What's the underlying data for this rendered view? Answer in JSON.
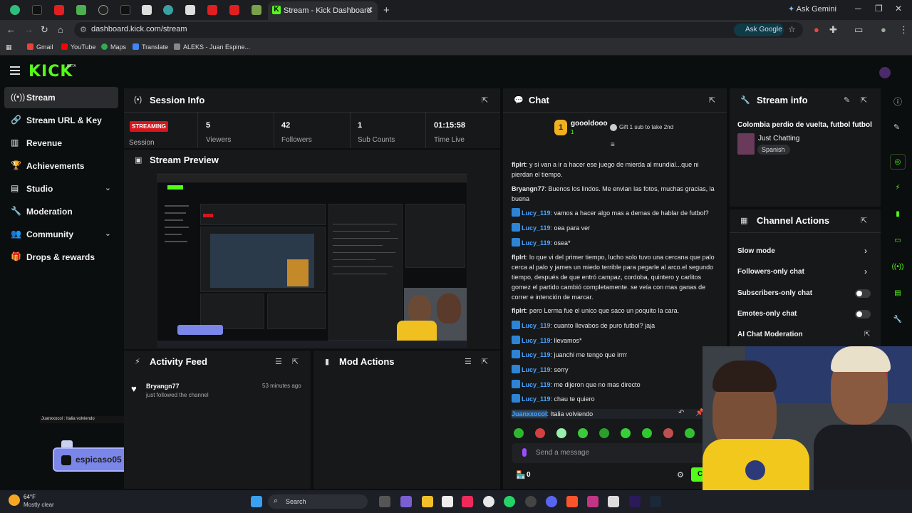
{
  "browser": {
    "active_tab_title": "Stream - Kick Dashboard",
    "ask_gemini": "Ask Gemini",
    "url": "dashboard.kick.com/stream",
    "ask_google": "Ask Google",
    "bookmarks": [
      "Gmail",
      "YouTube",
      "Maps",
      "Translate",
      "ALEKS - Juan Espine..."
    ]
  },
  "header": {
    "logo": "KICK",
    "beta": "BETA"
  },
  "sidebar": {
    "items": [
      {
        "label": "Stream",
        "icon": "broadcast-icon"
      },
      {
        "label": "Stream URL & Key",
        "icon": "link-icon"
      },
      {
        "label": "Revenue",
        "icon": "chart-icon"
      },
      {
        "label": "Achievements",
        "icon": "trophy-icon"
      },
      {
        "label": "Studio",
        "icon": "layout-icon"
      },
      {
        "label": "Moderation",
        "icon": "wrench-icon"
      },
      {
        "label": "Community",
        "icon": "people-icon"
      },
      {
        "label": "Drops & rewards",
        "icon": "gift-icon"
      }
    ]
  },
  "session": {
    "title": "Session Info",
    "status": "STREAMING",
    "session_label": "Session",
    "stats": [
      {
        "value": "5",
        "label": "Viewers"
      },
      {
        "value": "42",
        "label": "Followers"
      },
      {
        "value": "1",
        "label": "Sub Counts"
      },
      {
        "value": "01:15:58",
        "label": "Time Live"
      }
    ]
  },
  "preview": {
    "title": "Stream Preview"
  },
  "activity": {
    "title": "Activity Feed",
    "item_user": "Bryangn77",
    "item_text": "just followed the channel",
    "item_time": "53 minutes ago"
  },
  "mod_actions": {
    "title": "Mod Actions"
  },
  "overlay": {
    "chat_line": "Juanxxocol : Italia volviendo",
    "social_1": "espicaso05",
    "social_2": "espicaso05"
  },
  "chat": {
    "title": "Chat",
    "gift_user": "goooldooo",
    "gift_count": "1",
    "gift_text": "Gift 1 sub to take 2nd",
    "messages": [
      {
        "user": "flplrt",
        "text": "y si van a ir a hacer ese juego de mierda al mundial...que ni pierdan el tiempo.",
        "color": "#ffffff"
      },
      {
        "user": "Bryangn77",
        "text": "Buenos los lindos. Me envian las fotos, muchas gracias, la buena",
        "color": "#ffffff"
      },
      {
        "user": "Lucy_119",
        "text": "vamos a hacer algo mas a demas de hablar de futbol?",
        "color": "#4aa3ff"
      },
      {
        "user": "Lucy_119",
        "text": "oea para ver",
        "color": "#4aa3ff"
      },
      {
        "user": "Lucy_119",
        "text": "osea*",
        "color": "#4aa3ff"
      },
      {
        "user": "flplrt",
        "text": "lo que vi del primer tiempo, lucho solo tuvo una cercana que palo cerca al palo y james un miedo terrible para pegarle al arco.el segundo tiempo, después de que entró campaz, cordoba, quintero y carlitos gomez el partido cambió completamente. se veía con mas ganas de correr e intención de marcar.",
        "color": "#ffffff"
      },
      {
        "user": "flplrt",
        "text": "pero Lerma fue el unico que saco un poquito la cara.",
        "color": "#ffffff"
      },
      {
        "user": "Lucy_119",
        "text": "cuanto llevabos de puro futbol? jaja",
        "color": "#4aa3ff"
      },
      {
        "user": "Lucy_119",
        "text": "llevamos*",
        "color": "#4aa3ff"
      },
      {
        "user": "Lucy_119",
        "text": "juanchi me tengo que irrrr",
        "color": "#4aa3ff"
      },
      {
        "user": "Lucy_119",
        "text": "sorry",
        "color": "#4aa3ff"
      },
      {
        "user": "Lucy_119",
        "text": "me dijeron que no mas directo",
        "color": "#4aa3ff"
      },
      {
        "user": "Lucy_119",
        "text": "chau te quiero",
        "color": "#4aa3ff"
      },
      {
        "user": "Juanxxocol",
        "text": "Italia volviendo",
        "color": "#4aa3ff"
      }
    ],
    "placeholder": "Send a message",
    "points": "0",
    "chat_button": "Ch"
  },
  "stream_info": {
    "title": "Stream info",
    "stream_title": "Colombia perdio de vuelta, futbol futbol",
    "category": "Just Chatting",
    "language": "Spanish"
  },
  "channel_actions": {
    "title": "Channel Actions",
    "items": [
      "Slow mode",
      "Followers-only chat",
      "Subscribers-only chat",
      "Emotes-only chat",
      "AI Chat Moderation"
    ]
  },
  "taskbar": {
    "weather_temp": "64°F",
    "weather_text": "Mostly clear",
    "search": "Search"
  },
  "colors": {
    "accent": "#53fc18",
    "live": "#d6161c",
    "mention": "#4aa3ff"
  }
}
